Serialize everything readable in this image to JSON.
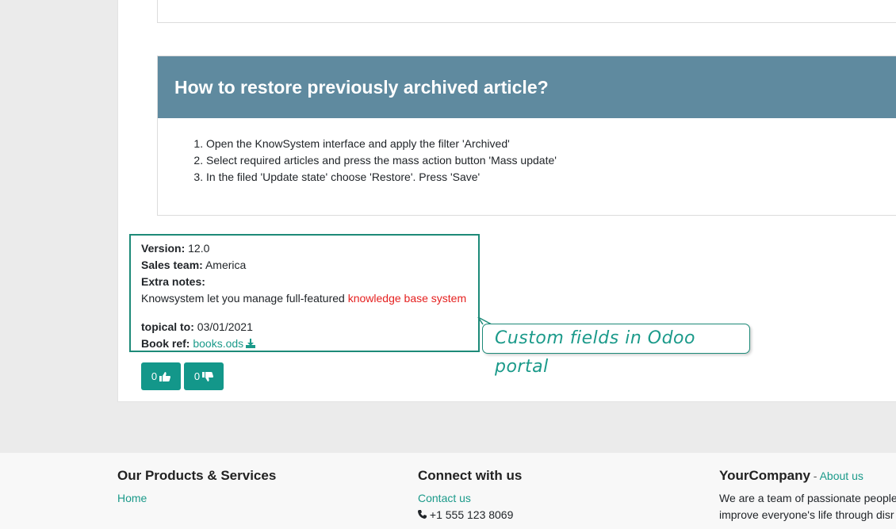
{
  "article": {
    "title": "How to restore previously archived article?",
    "steps": [
      "Open the KnowSystem interface and apply the filter 'Archived'",
      "Select required articles and press the mass action button 'Mass update'",
      "In the filed 'Update state' choose 'Restore'. Press 'Save'"
    ]
  },
  "fields": {
    "version_label": "Version:",
    "version_value": "12.0",
    "sales_team_label": "Sales team:",
    "sales_team_value": "America",
    "extra_notes_label": "Extra notes:",
    "extra_notes_text": "Knowsystem let you manage full-featured",
    "extra_notes_highlight": "knowledge base system",
    "topical_label": "topical to:",
    "topical_value": "03/01/2021",
    "book_ref_label": "Book ref:",
    "book_ref_link": "books.ods"
  },
  "callout": {
    "text": "Custom fields in Odoo portal"
  },
  "votes": {
    "likes": "0",
    "dislikes": "0"
  },
  "footer": {
    "products_title": "Our Products & Services",
    "home_link": "Home",
    "connect_title": "Connect with us",
    "contact_link": "Contact us",
    "phone": "+1 555 123 8069",
    "company_name": "YourCompany",
    "separator": " - ",
    "about_link": "About us",
    "about_line1": "We are a team of passionate people",
    "about_line2": "improve everyone's life through disr"
  },
  "colors": {
    "header_bg": "#5f8a9f",
    "accent": "#1b9a8a",
    "highlight": "#e5201f"
  }
}
